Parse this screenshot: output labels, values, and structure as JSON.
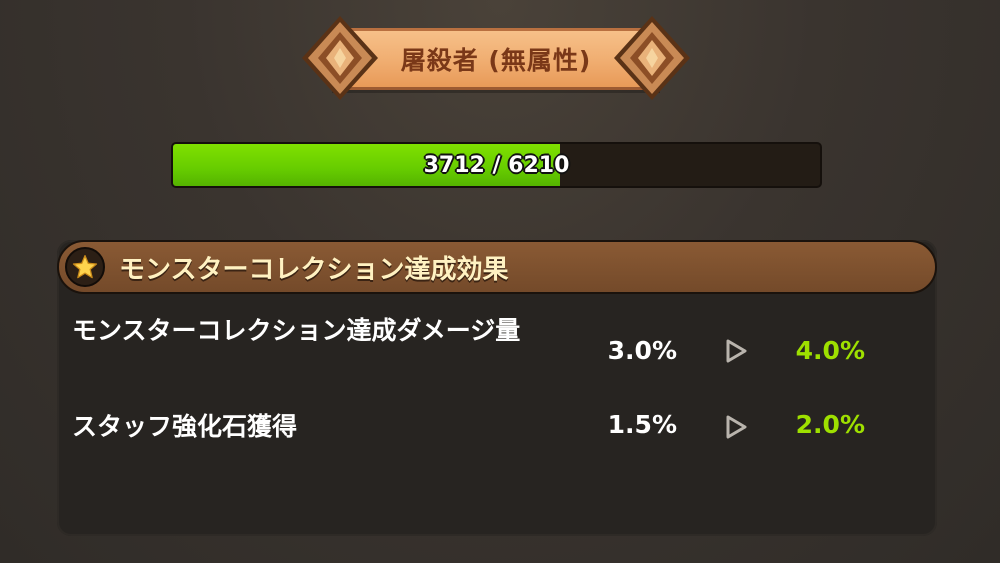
{
  "header": {
    "title": "屠殺者 (無属性)"
  },
  "progress": {
    "current": 3712,
    "max": 6210,
    "label": "3712 / 6210"
  },
  "panel": {
    "title": "モンスターコレクション達成効果",
    "rows": [
      {
        "label": "モンスターコレクション達成ダメージ量",
        "from": "3.0%",
        "to": "4.0%"
      },
      {
        "label": "スタッフ強化石獲得",
        "from": "1.5%",
        "to": "2.0%"
      }
    ]
  },
  "icons": {
    "banner_cap": "diamond-ornament-icon",
    "header_badge": "star-icon",
    "row_arrow": "play-arrow-icon"
  },
  "colors": {
    "progress_fill": "#66cc00",
    "new_value": "#9ee000",
    "panel_title": "#fff2c2",
    "banner_title": "#7a3818"
  }
}
